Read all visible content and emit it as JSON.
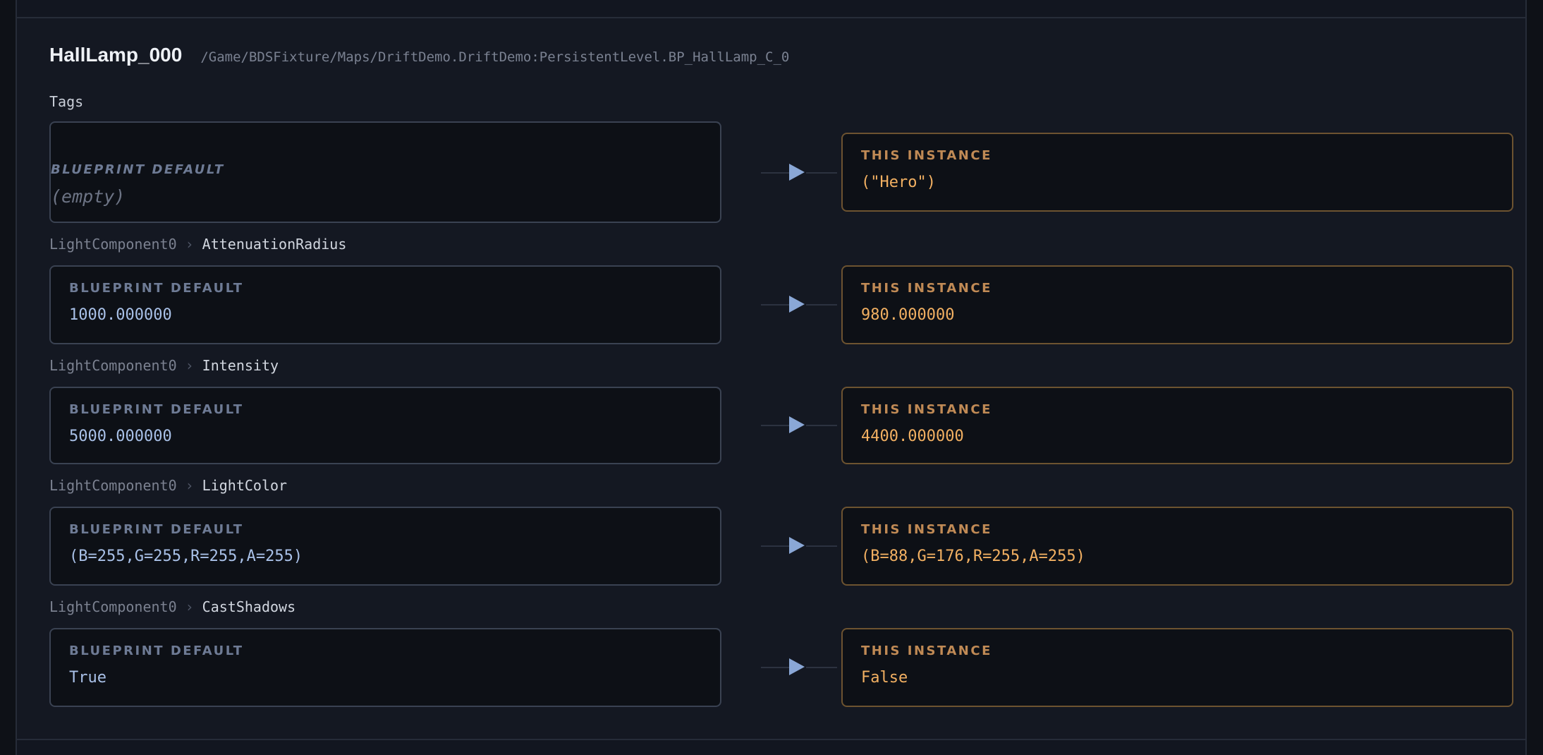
{
  "actor": {
    "name": "HallLamp_000",
    "path": "/Game/BDSFixture/Maps/DriftDemo.DriftDemo:PersistentLevel.BP_HallLamp_C_0"
  },
  "labels": {
    "default_heading": "BLUEPRINT DEFAULT",
    "instance_heading": "THIS INSTANCE",
    "separator": "›"
  },
  "properties": [
    {
      "label": "Tags",
      "component": "",
      "property": "Tags",
      "default_value": "(empty)",
      "instance_value": "(\"Hero\")"
    },
    {
      "label": "LightComponent0 › AttenuationRadius",
      "component": "LightComponent0",
      "property": "AttenuationRadius",
      "default_value": "1000.000000",
      "instance_value": "980.000000"
    },
    {
      "label": "LightComponent0 › Intensity",
      "component": "LightComponent0",
      "property": "Intensity",
      "default_value": "5000.000000",
      "instance_value": "4400.000000"
    },
    {
      "label": "LightComponent0 › LightColor",
      "component": "LightComponent0",
      "property": "LightColor",
      "default_value": "(B=255,G=255,R=255,A=255)",
      "instance_value": "(B=88,G=176,R=255,A=255)"
    },
    {
      "label": "LightComponent0 › CastShadows",
      "component": "LightComponent0",
      "property": "CastShadows",
      "default_value": "True",
      "instance_value": "False"
    }
  ],
  "colors": {
    "default_border": "#3a4252",
    "instance_border": "#6d5330",
    "default_value": "#a9c1e8",
    "instance_value": "#f2b062",
    "arrow": "#8aa7d6"
  },
  "icons": {
    "arrow": "arrow-right-icon"
  }
}
